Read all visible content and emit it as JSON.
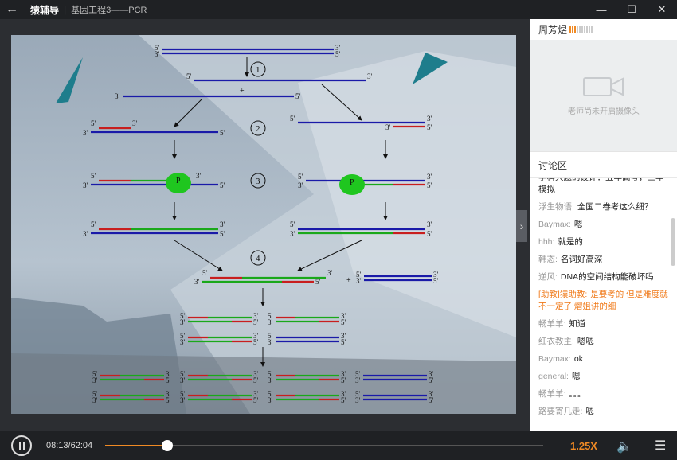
{
  "titlebar": {
    "back_icon": "arrow-left-icon",
    "brand": "猿辅导",
    "course": "基因工程3——PCR"
  },
  "window": {
    "min": "—",
    "max": "☐",
    "close": "✕"
  },
  "teacher": {
    "name": "周芳煜",
    "signal_level": 0.3
  },
  "camera": {
    "message": "老师尚未开启摄像头"
  },
  "discussion": {
    "title": "讨论区",
    "messages": [
      {
        "user": "",
        "text": "学科大题的设计：五年高考，三年模拟",
        "ta": false
      },
      {
        "user": "浮生物语:",
        "text": "全国二卷考这么细？",
        "ta": false
      },
      {
        "user": "Baymax:",
        "text": "嗯",
        "ta": false
      },
      {
        "user": "hhh:",
        "text": "就是的",
        "ta": false
      },
      {
        "user": "韩态:",
        "text": "名词好高深",
        "ta": false
      },
      {
        "user": "逆风:",
        "text": "DNA的空间结构能破坏吗",
        "ta": false
      },
      {
        "user": "[助教]猿助教:",
        "text": "是要考的  但是难度就不一定了  熠姐讲的细",
        "ta": true
      },
      {
        "user": "畅羊羊:",
        "text": "知道",
        "ta": false
      },
      {
        "user": "红衣教主:",
        "text": "嗯嗯",
        "ta": false
      },
      {
        "user": "Baymax:",
        "text": "ok",
        "ta": false
      },
      {
        "user": "general:",
        "text": "嗯",
        "ta": false
      },
      {
        "user": "畅羊羊:",
        "text": "。。。",
        "ta": false
      },
      {
        "user": "路要寄几走:",
        "text": "嗯",
        "ta": false
      }
    ]
  },
  "player": {
    "current_time": "08:13",
    "total_time": "62:04",
    "time_display": "08:13/62:04",
    "progress": 0.1426,
    "speed": "1.25X",
    "volume_icon": "speaker-icon",
    "menu_icon": "menu-icon"
  },
  "slide": {
    "steps": [
      "1",
      "2",
      "3",
      "4"
    ],
    "primer_label": "P",
    "plus": "+",
    "prime5": "5'",
    "prime3": "3'",
    "colors": {
      "template": "#1a1aa8",
      "primer": "#c81e1e",
      "new_strand": "#1aa81a"
    }
  }
}
